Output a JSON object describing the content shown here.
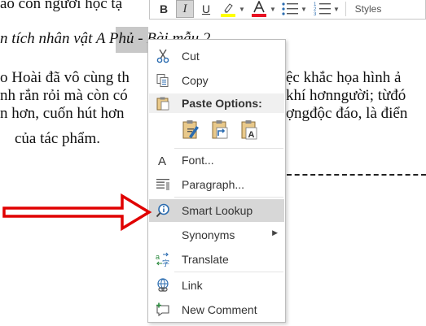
{
  "document": {
    "line1": "ảo con người học tậ",
    "heading": "n tích nhân vật A Phủ - Bài mẫu 2",
    "para_line1_left": "o Hoài đã vô cùng th",
    "para_line1_right": "ệc khắc họa hình ả",
    "para_line2_left": "nh rắn rỏi mà còn có",
    "para_line2_right": "khí hơnngười; từđó",
    "para_line3_left": "n hơn, cuốn hút hơn",
    "para_line3_right": "ợngđộc đáo, là điển",
    "para_line4": "của tác phẩm."
  },
  "mini_toolbar": {
    "bold": "B",
    "italic": "I",
    "underline": "U",
    "styles": "Styles",
    "highlight_color": "#ffff00",
    "font_color": "#e81123"
  },
  "context_menu": {
    "cut": "Cut",
    "copy": "Copy",
    "paste_options": "Paste Options:",
    "font": "Font...",
    "paragraph": "Paragraph...",
    "smart_lookup": "Smart Lookup",
    "synonyms": "Synonyms",
    "translate": "Translate",
    "link": "Link",
    "new_comment": "New Comment"
  },
  "colors": {
    "arrow": "#e00000",
    "menu_hover": "#d7d7d7",
    "icon_blue": "#2b6cb0"
  }
}
